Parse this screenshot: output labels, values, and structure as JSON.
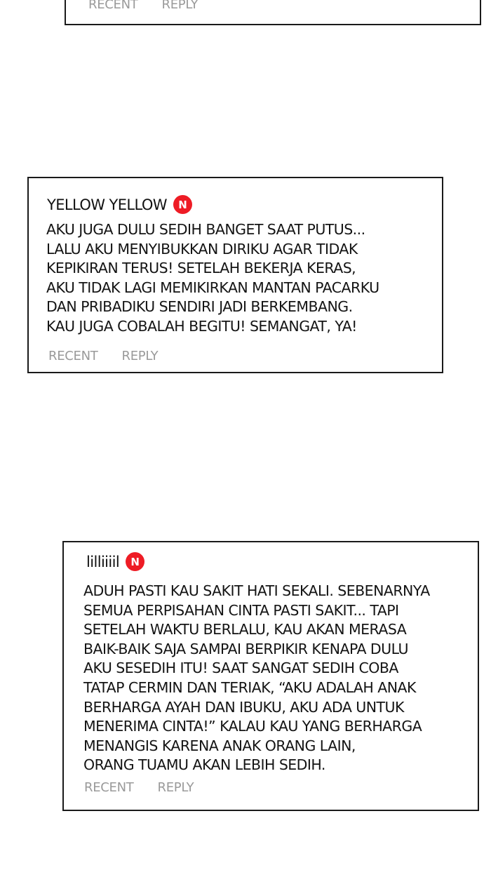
{
  "theme": {
    "badge_color": "#ee1c25",
    "action_text_color": "#9a9a9a"
  },
  "comments": [
    {
      "username": "",
      "badge": "",
      "lines": [],
      "actions": {
        "recent": "RECENT",
        "reply": "REPLY"
      }
    },
    {
      "username": "YELLOW YELLOW",
      "badge": "N",
      "lines": [
        "AKU JUGA DULU SEDIH BANGET SAAT PUTUS...",
        "LALU AKU MENYIBUKKAN DIRIKU AGAR TIDAK",
        "KEPIKIRAN TERUS! SETELAH BEKERJA KERAS,",
        "AKU TIDAK LAGI MEMIKIRKAN MANTAN PACARKU",
        "DAN PRIBADIKU SENDIRI JADI BERKEMBANG.",
        "KAU JUGA COBALAH BEGITU! SEMANGAT, YA!"
      ],
      "actions": {
        "recent": "RECENT",
        "reply": "REPLY"
      }
    },
    {
      "username": "lilliiiil",
      "badge": "N",
      "lines": [
        "ADUH PASTI KAU SAKIT HATI SEKALI. SEBENARNYA",
        "SEMUA PERPISAHAN CINTA PASTI SAKIT... TAPI",
        "SETELAH WAKTU BERLALU, KAU AKAN MERASA",
        "BAIK-BAIK SAJA SAMPAI BERPIKIR KENAPA DULU",
        "AKU SESEDIH ITU! SAAT SANGAT SEDIH COBA",
        "TATAP CERMIN DAN TERIAK, “AKU ADALAH ANAK",
        "BERHARGA AYAH DAN IBUKU, AKU ADA UNTUK",
        "MENERIMA CINTA!” KALAU KAU YANG BERHARGA",
        "MENANGIS KARENA ANAK ORANG LAIN,",
        "ORANG TUAMU AKAN LEBIH SEDIH."
      ],
      "actions": {
        "recent": "RECENT",
        "reply": "REPLY"
      }
    }
  ]
}
